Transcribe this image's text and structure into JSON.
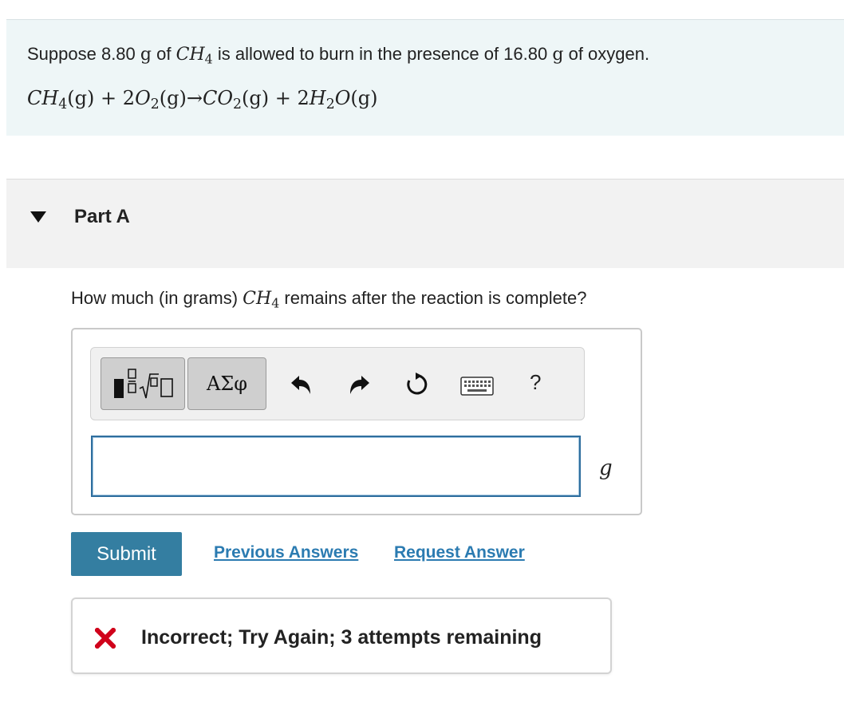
{
  "intro": {
    "text_prefix": "Suppose 8.80",
    "unit_1": "g",
    "text_middle_1": "of",
    "species": "CH",
    "species_sub": "4",
    "text_middle_2": "is allowed to burn in the presence of 16.80",
    "unit_2": "g",
    "text_suffix": "of oxygen.",
    "equation": {
      "r1": "CH",
      "r1_sub": "4",
      "r1_state": "(g)",
      "plus_1": "+",
      "r2_coef": "2",
      "r2": "O",
      "r2_sub": "2",
      "r2_state": "(g)",
      "arrow": "→",
      "p1": "CO",
      "p1_sub": "2",
      "p1_state": "(g)",
      "plus_2": "+",
      "p2_coef": "2",
      "p2": "H",
      "p2_sub": "2",
      "p2_rest": "O",
      "p2_state": "(g)"
    }
  },
  "part": {
    "title": "Part A"
  },
  "question": {
    "prefix": "How much (in grams)",
    "species": "CH",
    "species_sub": "4",
    "suffix": "remains after the reaction is complete?"
  },
  "toolbar": {
    "symbols_label": "ΑΣφ",
    "help_label": "?",
    "icons": [
      "templates-icon",
      "undo-icon",
      "redo-icon",
      "reset-icon",
      "keyboard-icon",
      "help-icon"
    ]
  },
  "answer": {
    "value": "",
    "unit": "g"
  },
  "actions": {
    "submit_label": "Submit",
    "previous_answers_label": "Previous Answers",
    "request_answer_label": "Request Answer"
  },
  "feedback": {
    "message": "Incorrect; Try Again; 3 attempts remaining",
    "icon_color": "#d0021b"
  },
  "colors": {
    "intro_bg": "#eef6f7",
    "part_header_bg": "#f2f2f2",
    "submit_bg": "#347ea1",
    "link": "#2b7bb1",
    "input_border": "#2f6e9e"
  }
}
